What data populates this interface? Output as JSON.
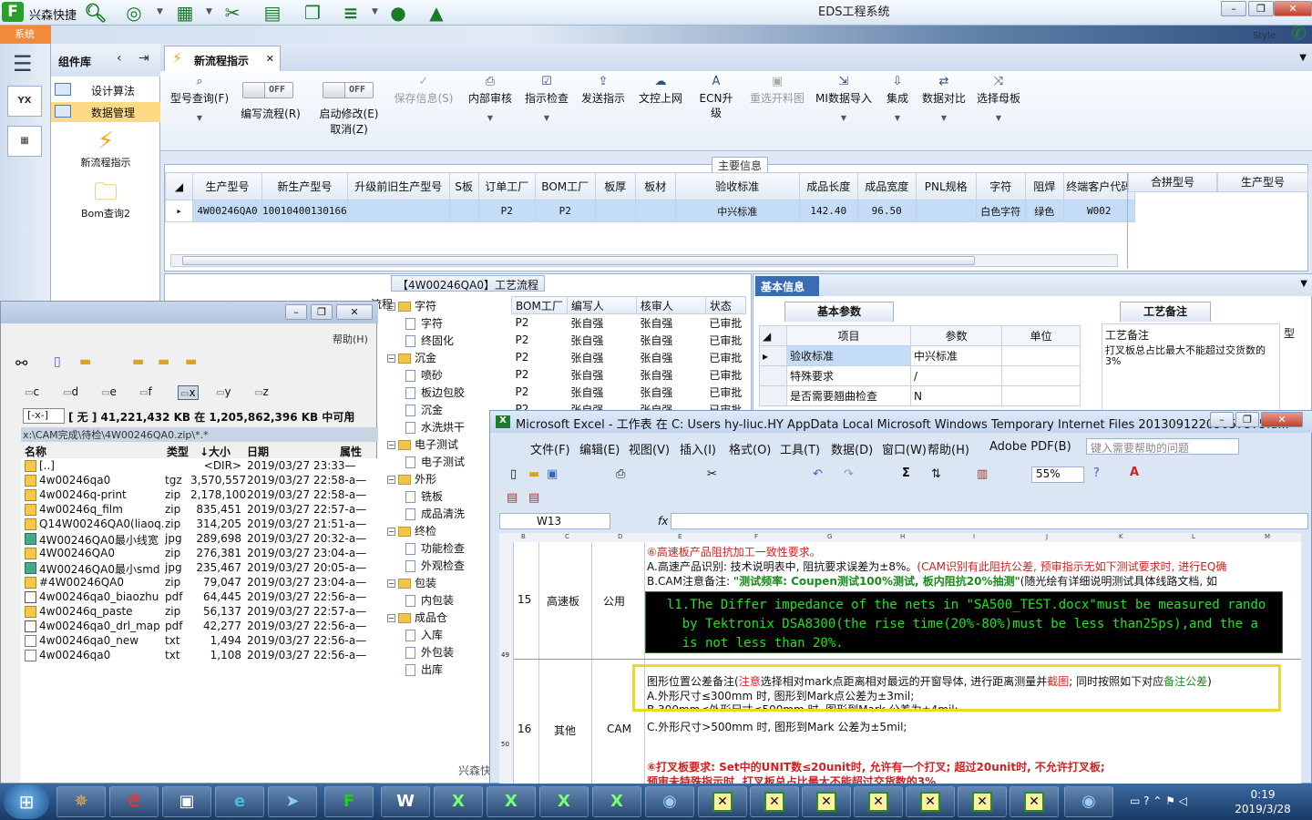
{
  "app": {
    "name": "兴森快捷",
    "window_title": "EDS工程系统",
    "style_label": "Style",
    "system_tab": "系统"
  },
  "nav": {
    "side_icons": [
      "YX",
      "grid"
    ]
  },
  "components": {
    "title": "组件库",
    "items": [
      "设计算法",
      "数据管理"
    ],
    "actions": [
      "新流程指示",
      "Bom查询2"
    ]
  },
  "doc_tab": {
    "title": "新流程指示"
  },
  "ribbon": {
    "b1": "型号查询(F)",
    "t1": "编写流程(R)",
    "t2": "启动修改(E)",
    "t2b": "取消(Z)",
    "off": "OFF",
    "b2": "保存信息(S)",
    "b3": "内部审核",
    "b4": "指示检查",
    "b5": "发送指示",
    "b6": "文控上网",
    "b7": "ECN升级",
    "b8": "重选开料图",
    "b9": "MI数据导入",
    "b10": "集成",
    "b11": "数据对比",
    "b12": "选择母板"
  },
  "main": {
    "legend": "主要信息",
    "cols": [
      "生产型号",
      "新生产型号",
      "升级前旧生产型号",
      "S板",
      "订单工厂",
      "BOM工厂",
      "板厚",
      "板材",
      "验收标准",
      "成品长度",
      "成品宽度",
      "PNL规格",
      "字符",
      "阻焊",
      "终端客户代码"
    ],
    "row": [
      "4W00246QA0",
      "10010400130166",
      "",
      "",
      "P2",
      "P2",
      "",
      "",
      "中兴标准",
      "142.40",
      "96.50",
      "",
      "白色字符",
      "绿色",
      "W002"
    ],
    "side_cols": [
      "合拼型号",
      "生产型号"
    ]
  },
  "process": {
    "title": "【4W00246QA0】工艺流程",
    "col_flow": "流程",
    "cols": [
      "BOM工厂",
      "编写人",
      "核审人",
      "状态"
    ],
    "tree": [
      {
        "t": "f",
        "n": "字符"
      },
      {
        "t": "d",
        "n": "字符"
      },
      {
        "t": "d",
        "n": "终固化"
      },
      {
        "t": "f",
        "n": "沉金"
      },
      {
        "t": "d",
        "n": "喷砂"
      },
      {
        "t": "d",
        "n": "板边包胶"
      },
      {
        "t": "d",
        "n": "沉金"
      },
      {
        "t": "d",
        "n": "水洗烘干"
      },
      {
        "t": "f",
        "n": "电子测试"
      },
      {
        "t": "d",
        "n": "电子测试"
      },
      {
        "t": "f",
        "n": "外形"
      },
      {
        "t": "d",
        "n": "铣板"
      },
      {
        "t": "d",
        "n": "成品清洗"
      },
      {
        "t": "f",
        "n": "终检"
      },
      {
        "t": "d",
        "n": "功能检查"
      },
      {
        "t": "d",
        "n": "外观检查"
      },
      {
        "t": "f",
        "n": "包装"
      },
      {
        "t": "d",
        "n": "内包装"
      },
      {
        "t": "f",
        "n": "成品仓"
      },
      {
        "t": "d",
        "n": "入库"
      },
      {
        "t": "d",
        "n": "外包装"
      },
      {
        "t": "d",
        "n": "出库"
      }
    ],
    "rows": [
      [
        "P2",
        "张自强",
        "张自强",
        "已审批"
      ],
      [
        "P2",
        "张自强",
        "张自强",
        "已审批"
      ],
      [
        "P2",
        "张自强",
        "张自强",
        "已审批"
      ],
      [
        "P2",
        "张自强",
        "张自强",
        "已审批"
      ],
      [
        "P2",
        "张自强",
        "张自强",
        "已审批"
      ],
      [
        "P2",
        "张自强",
        "张自强",
        "已审批"
      ]
    ],
    "footer": "兴森快"
  },
  "basic": {
    "tab": "基本信息",
    "params_tab": "基本参数",
    "cols": [
      "项目",
      "参数",
      "单位"
    ],
    "rows": [
      [
        "验收标准",
        "中兴标准",
        ""
      ],
      [
        "特殊要求",
        "/",
        ""
      ],
      [
        "是否需要翘曲检查",
        "N",
        ""
      ]
    ],
    "note_tab": "工艺备注",
    "note_head": "工艺备注",
    "note_col2": "型",
    "note_text": "打叉板总占比最大不能超过交货数的3%"
  },
  "fm": {
    "help": "帮助(H)",
    "drives": [
      "c",
      "d",
      "e",
      "f",
      "x",
      "y",
      "z"
    ],
    "drive_label": "[-x-]",
    "free": "[ 无 ]  41,221,432 KB 在 1,205,862,396 KB 中可用",
    "path": "x:\\CAM完成\\待检\\4W00246QA0.zip\\*.*",
    "cols": [
      "名称",
      "类型",
      "↓大小",
      "日期",
      "属性"
    ],
    "files": [
      [
        "[..]",
        "",
        "<DIR>",
        "2019/03/27 23:33—",
        "d"
      ],
      [
        "4w00246qa0",
        "tgz",
        "3,570,557",
        "2019/03/27 22:58-a—",
        "a"
      ],
      [
        "4w00246q-print",
        "zip",
        "2,178,100",
        "2019/03/27 22:58-a—",
        "a"
      ],
      [
        "4w00246q_film",
        "zip",
        "835,451",
        "2019/03/27 22:57-a—",
        "a"
      ],
      [
        "Q14W00246QA0(liaoq..",
        "zip",
        "314,205",
        "2019/03/27 21:51-a—",
        "a"
      ],
      [
        "4W00246QA0最小线宽",
        "jpg",
        "289,698",
        "2019/03/27 20:32-a—",
        "j"
      ],
      [
        "4W00246QA0",
        "zip",
        "276,381",
        "2019/03/27 23:04-a—",
        "a"
      ],
      [
        "4W00246QA0最小smd",
        "jpg",
        "235,467",
        "2019/03/27 20:05-a—",
        "j"
      ],
      [
        "#4W00246QA0",
        "zip",
        "79,047",
        "2019/03/27 23:04-a—",
        "a"
      ],
      [
        "4w00246qa0_biaozhu",
        "pdf",
        "64,445",
        "2019/03/27 22:56-a—",
        "p"
      ],
      [
        "4w00246q_paste",
        "zip",
        "56,137",
        "2019/03/27 22:57-a—",
        "a"
      ],
      [
        "4w00246qa0_drl_map",
        "pdf",
        "42,277",
        "2019/03/27 22:56-a—",
        "p"
      ],
      [
        "4w00246qa0_new",
        "txt",
        "1,494",
        "2019/03/27 22:56-a—",
        "t"
      ],
      [
        "4w00246qa0",
        "txt",
        "1,108",
        "2019/03/27 22:56-a—",
        "t"
      ]
    ]
  },
  "excel": {
    "title": "Microsoft Excel - 工作表 在 C: Users hy-liuc.HY AppData Local Microsoft Windows Temporary Internet Files 20130912205657375.d...",
    "menu": [
      "文件(F)",
      "编辑(E)",
      "视图(V)",
      "插入(I)",
      "格式(O)",
      "工具(T)",
      "数据(D)",
      "窗口(W)",
      "帮助(H)",
      "Adobe PDF(B)"
    ],
    "help_placeholder": "键入需要帮助的问题",
    "zoom": "55%",
    "cellref": "W13",
    "fx": "fx",
    "cols": [
      "B",
      "C",
      "D",
      "E",
      "F",
      "G",
      "H",
      "I",
      "J",
      "K",
      "L",
      "M"
    ],
    "r1": {
      "num": "15",
      "a": "高速板",
      "b": "公用",
      "rowno": "49",
      "l1": "⑥高速板产品阻抗加工一致性要求。",
      "l2": "A.高速产品识别: 技术说明表中, 阻抗要求误差为±8%。",
      "l2r": "(CAM识别有此阻抗公差, 预审指示无如下测试要求时, 进行EQ确",
      "l3a": "B.CAM注意备注: ",
      "l3b": "\"测试频率: Coupen测试100%测试, 板内阻抗20%抽测\"",
      "l3c": "(随光绘有详细说明测试具体线路文档, 如",
      "green": "  l1.The Differ impedance of the nets in \"SA500_TEST.docx\"must be measured rando\n    by Tektronix DSA8300(the rise time(20%-80%)must be less than25ps),and the a\n    is not less than 20%."
    },
    "r2": {
      "num": "16",
      "a": "其他",
      "b": "CAM",
      "rowno": "50",
      "y1a": "图形位置公差备注(",
      "y1b": "注意",
      "y1c": "选择相对mark点距离相对最远的开窗导体, 进行距离测量并",
      "y1d": "截图",
      "y1e": "; 同时按照如下对应",
      "y1f": "备注公差",
      ")": ")",
      "y2": "A.外形尺寸≤300mm 时, 图形到Mark点公差为±3mil;",
      "y3": "B.300mm<外形尺寸≤500mm 时, 图形到Mark 公差为±4mil;",
      "y4": "C.外形尺寸>500mm 时, 图形到Mark 公差为±5mil;",
      "r1": "⑥打叉板要求: Set中的UNIT数≤20unit时, 允许有一个打叉; 超过20unit时, 不允许打叉板;",
      "r2": "预审未特殊指示时, 打叉板总占比最大不能超过交货数的3%"
    }
  },
  "taskbar": {
    "time": "0:19",
    "date": "2019/3/28"
  }
}
